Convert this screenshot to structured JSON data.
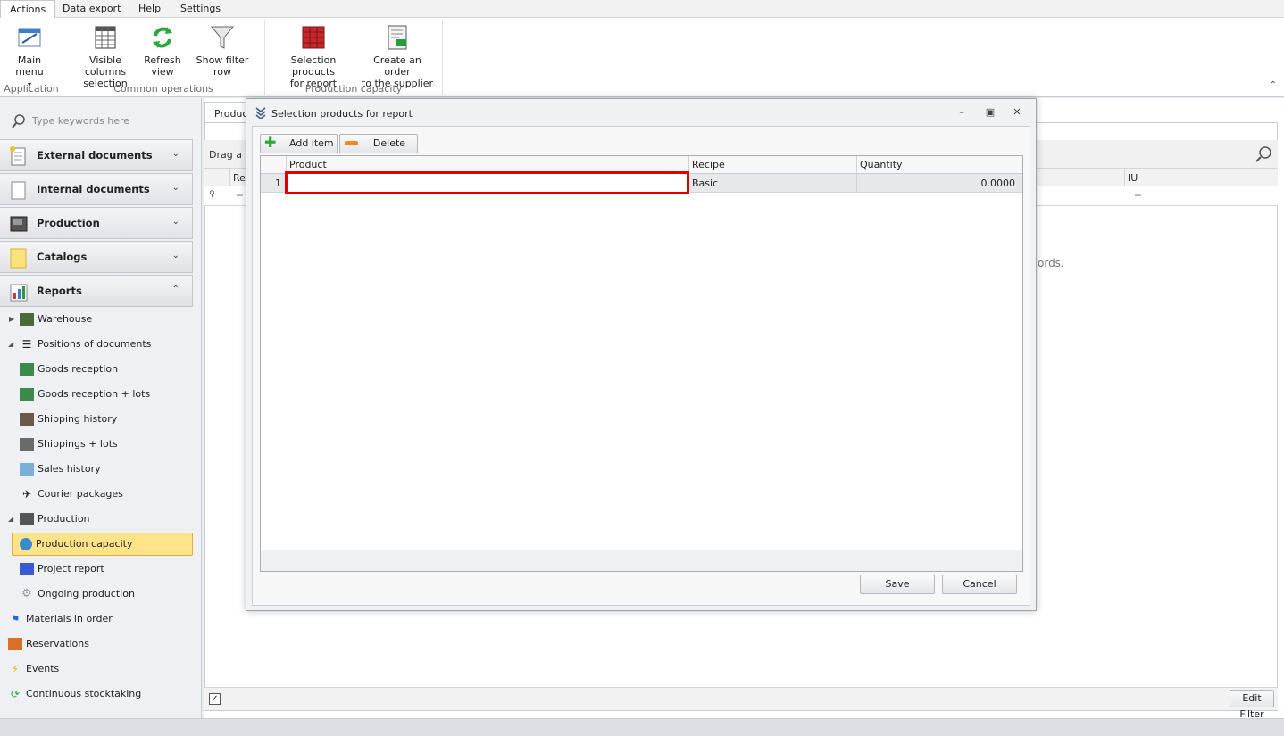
{
  "menu": {
    "tabs": [
      "Actions",
      "Data export",
      "Help",
      "Settings"
    ]
  },
  "ribbon": {
    "buttons": {
      "main_menu": "Main menu",
      "visible_columns_1": "Visible columns",
      "visible_columns_2": "selection",
      "refresh_1": "Refresh",
      "refresh_2": "view",
      "show_filter": "Show filter row",
      "selection_products_1": "Selection products",
      "selection_products_2": "for report",
      "create_order_1": "Create an order",
      "create_order_2": "to the supplier"
    },
    "groups": {
      "application": "Application",
      "common": "Common operations",
      "production_capacity": "Production capacity"
    }
  },
  "sidebar": {
    "search_placeholder": "Type keywords here",
    "groups": [
      "External documents",
      "Internal documents",
      "Production",
      "Catalogs",
      "Reports"
    ],
    "tree": {
      "warehouse": "Warehouse",
      "positions": "Positions of documents",
      "goods_reception": "Goods reception",
      "goods_reception_lots": "Goods reception + lots",
      "shipping_history": "Shipping history",
      "shippings_lots": "Shippings + lots",
      "sales_history": "Sales history",
      "courier": "Courier packages",
      "production": "Production",
      "production_capacity": "Production capacity",
      "project_report": "Project report",
      "ongoing": "Ongoing production",
      "materials": "Materials in order",
      "reservations": "Reservations",
      "events": "Events",
      "stocktaking": "Continuous stocktaking"
    }
  },
  "main": {
    "tab_label": "Product",
    "group_bar_text": "Drag a c",
    "col_re": "Re",
    "col_iu": "IU",
    "no_records_partial": "ords.",
    "edit_filter": "Edit Filter"
  },
  "dialog": {
    "title": "Selection products for report",
    "add_item": "Add item",
    "delete_item": "Delete item",
    "columns": {
      "product": "Product",
      "recipe": "Recipe",
      "quantity": "Quantity"
    },
    "rows": [
      {
        "num": "1",
        "product": "",
        "recipe": "Basic",
        "quantity": "0.0000"
      }
    ],
    "save": "Save",
    "cancel": "Cancel"
  },
  "colors": {
    "highlight_border": "#e00000",
    "selected_bg": "#fde48a",
    "selected_border": "#e6a93a"
  }
}
